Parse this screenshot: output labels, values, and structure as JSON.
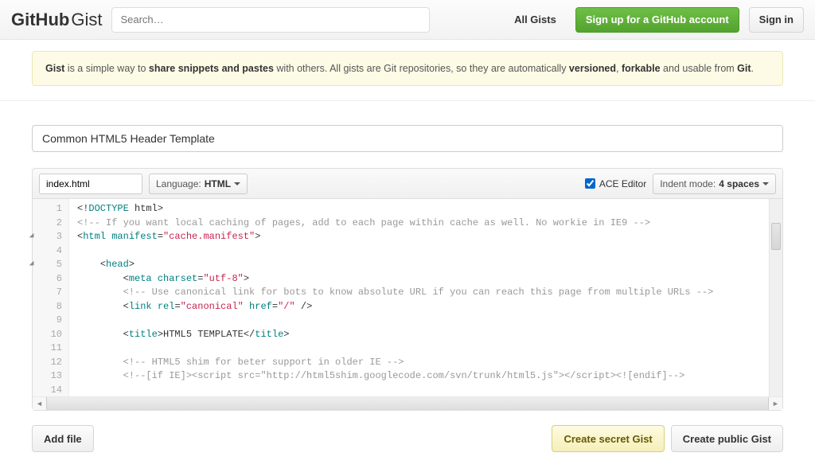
{
  "header": {
    "logo_bold": "GitHub",
    "logo_thin": "Gist",
    "search_placeholder": "Search…",
    "nav_all_gists": "All Gists",
    "signup_label": "Sign up for a GitHub account",
    "signin_label": "Sign in"
  },
  "intro": {
    "lead": "Gist",
    "text1": " is a simple way to ",
    "strong1": "share snippets and pastes",
    "text2": " with others. All gists are Git repositories, so they are automatically ",
    "strong2": "versioned",
    "comma": ", ",
    "strong3": "forkable",
    "text3": " and usable from ",
    "strong4": "Git",
    "period": "."
  },
  "gist": {
    "description": "Common HTML5 Header Template"
  },
  "file": {
    "filename": "index.html",
    "lang_label": "Language: ",
    "lang_value": "HTML",
    "ace_label": "ACE Editor",
    "ace_checked": true,
    "indent_label": "Indent mode: ",
    "indent_value": "4 spaces"
  },
  "editor": {
    "lines": [
      {
        "n": 1,
        "fold": false,
        "tokens": [
          [
            "p",
            "<!"
          ],
          [
            "t",
            "DOCTYPE"
          ],
          [
            "kw",
            " html"
          ],
          [
            "p",
            ">"
          ]
        ]
      },
      {
        "n": 2,
        "fold": false,
        "tokens": [
          [
            "c",
            "<!-- If you want local caching of pages, add to each page within cache as well. No workie in IE9 -->"
          ]
        ]
      },
      {
        "n": 3,
        "fold": true,
        "tokens": [
          [
            "p",
            "<"
          ],
          [
            "t",
            "html"
          ],
          [
            "a",
            " manifest"
          ],
          [
            "p",
            "="
          ],
          [
            "s",
            "\"cache.manifest\""
          ],
          [
            "p",
            ">"
          ]
        ]
      },
      {
        "n": 4,
        "fold": false,
        "tokens": []
      },
      {
        "n": 5,
        "fold": true,
        "tokens": [
          [
            "kw",
            "    "
          ],
          [
            "p",
            "<"
          ],
          [
            "t",
            "head"
          ],
          [
            "p",
            ">"
          ]
        ]
      },
      {
        "n": 6,
        "fold": false,
        "tokens": [
          [
            "kw",
            "        "
          ],
          [
            "p",
            "<"
          ],
          [
            "t",
            "meta"
          ],
          [
            "a",
            " charset"
          ],
          [
            "p",
            "="
          ],
          [
            "s",
            "\"utf-8\""
          ],
          [
            "p",
            ">"
          ]
        ]
      },
      {
        "n": 7,
        "fold": false,
        "tokens": [
          [
            "kw",
            "        "
          ],
          [
            "c",
            "<!-- Use canonical link for bots to know absolute URL if you can reach this page from multiple URLs -->"
          ]
        ]
      },
      {
        "n": 8,
        "fold": false,
        "tokens": [
          [
            "kw",
            "        "
          ],
          [
            "p",
            "<"
          ],
          [
            "t",
            "link"
          ],
          [
            "a",
            " rel"
          ],
          [
            "p",
            "="
          ],
          [
            "s",
            "\"canonical\""
          ],
          [
            "a",
            " href"
          ],
          [
            "p",
            "="
          ],
          [
            "s",
            "\"/\""
          ],
          [
            "p",
            " />"
          ]
        ]
      },
      {
        "n": 9,
        "fold": false,
        "tokens": []
      },
      {
        "n": 10,
        "fold": false,
        "tokens": [
          [
            "kw",
            "        "
          ],
          [
            "p",
            "<"
          ],
          [
            "t",
            "title"
          ],
          [
            "p",
            ">"
          ],
          [
            "kw",
            "HTML5 TEMPLATE"
          ],
          [
            "p",
            "</"
          ],
          [
            "t",
            "title"
          ],
          [
            "p",
            ">"
          ]
        ]
      },
      {
        "n": 11,
        "fold": false,
        "tokens": []
      },
      {
        "n": 12,
        "fold": false,
        "tokens": [
          [
            "kw",
            "        "
          ],
          [
            "c",
            "<!-- HTML5 shim for beter support in older IE -->"
          ]
        ]
      },
      {
        "n": 13,
        "fold": false,
        "tokens": [
          [
            "kw",
            "        "
          ],
          [
            "c",
            "<!--[if IE]><script src=\"http://html5shim.googlecode.com/svn/trunk/html5.js\"></​script><![endif]-->"
          ]
        ]
      },
      {
        "n": 14,
        "fold": false,
        "tokens": []
      }
    ]
  },
  "actions": {
    "add_file": "Add file",
    "create_secret": "Create secret Gist",
    "create_public": "Create public Gist"
  }
}
